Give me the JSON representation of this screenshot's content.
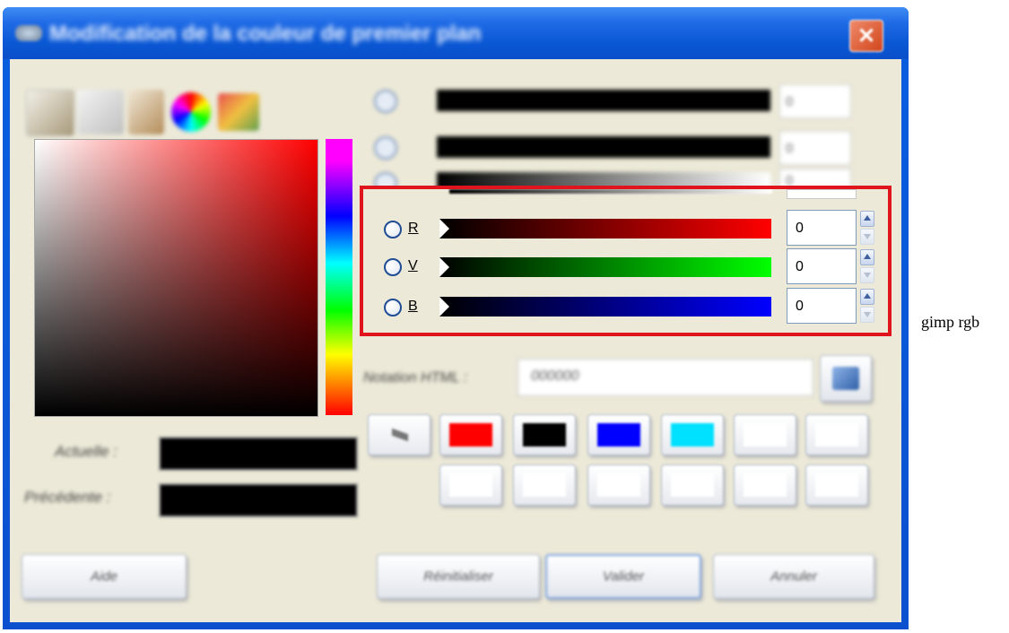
{
  "dialog": {
    "title": "Modification de la couleur de premier plan"
  },
  "tabs": [
    {
      "icon": "scales-icon"
    },
    {
      "icon": "printer-icon"
    },
    {
      "icon": "brush-icon"
    },
    {
      "icon": "color-wheel-icon"
    },
    {
      "icon": "palette-icon"
    }
  ],
  "swatch_labels": {
    "current": "Actuelle :",
    "previous": "Précédente :"
  },
  "hsv_rows": [
    {
      "value": "0"
    },
    {
      "value": "0"
    },
    {
      "value": "0"
    }
  ],
  "rgb_channels": [
    {
      "label": "R",
      "value": "0",
      "color": "#ff0000"
    },
    {
      "label": "V",
      "value": "0",
      "color": "#00ff00"
    },
    {
      "label": "B",
      "value": "0",
      "color": "#0000ff"
    }
  ],
  "html_notation": {
    "label": "Notation HTML :",
    "value": "000000"
  },
  "history_colors": [
    "#ff0000",
    "#000000",
    "#0000ff",
    "#00e0ff",
    "#ffffff",
    "#ffffff"
  ],
  "history_row2": [
    "#ffffff",
    "#ffffff",
    "#ffffff",
    "#ffffff",
    "#ffffff",
    "#ffffff"
  ],
  "buttons": {
    "help": "Aide",
    "reset": "Réinitialiser",
    "ok": "Valider",
    "cancel": "Annuler"
  },
  "highlight_color": "#e0141c",
  "caption": "gimp rgb"
}
